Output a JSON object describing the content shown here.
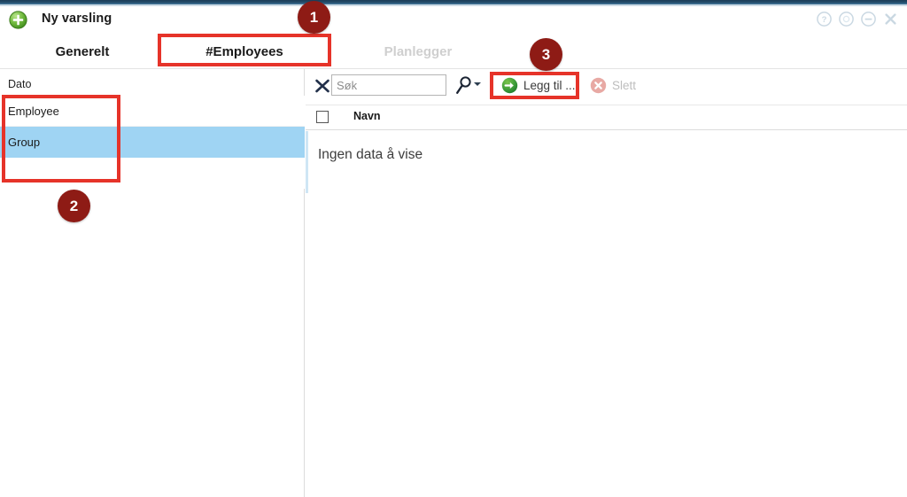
{
  "window": {
    "app_icon": "green-plus-circle-icon",
    "title": "Ny varsling",
    "controls": [
      {
        "name": "help-icon",
        "glyph": "?"
      },
      {
        "name": "restore-icon",
        "glyph": "o"
      },
      {
        "name": "minimize-icon",
        "glyph": "-"
      },
      {
        "name": "close-icon",
        "glyph": "x"
      }
    ]
  },
  "tabs": [
    {
      "label": "Generelt",
      "state": "inactive"
    },
    {
      "label": "#Employees",
      "state": "active"
    },
    {
      "label": "Planlegger",
      "state": "disabled"
    }
  ],
  "left_pane": {
    "header_label": "Dato",
    "items": [
      {
        "label": "Employee",
        "selected": false
      },
      {
        "label": "Group",
        "selected": true
      },
      {
        "label": "",
        "selected": false
      }
    ]
  },
  "toolbar": {
    "clear_icon": "close-x-icon",
    "search": {
      "value": "",
      "placeholder": "Søk"
    },
    "search_icon": "magnifier-icon",
    "search_dropdown_icon": "caret-down-icon",
    "add_button": {
      "label": "Legg til ...",
      "icon": "green-arrow-circle-icon",
      "enabled": true
    },
    "delete_button": {
      "label": "Slett",
      "icon": "red-x-circle-icon",
      "enabled": false
    }
  },
  "grid": {
    "columns": [
      {
        "type": "checkbox",
        "label": ""
      },
      {
        "type": "text",
        "label": "Navn"
      }
    ],
    "rows": [],
    "empty_message": "Ingen data å vise"
  },
  "annotations": {
    "badges": [
      {
        "number": "1",
        "target": "tab-employees"
      },
      {
        "number": "2",
        "target": "left-pane-list"
      },
      {
        "number": "3",
        "target": "add-button"
      }
    ],
    "highlight_color": "#e63329",
    "badge_color": "#8e1b15"
  }
}
